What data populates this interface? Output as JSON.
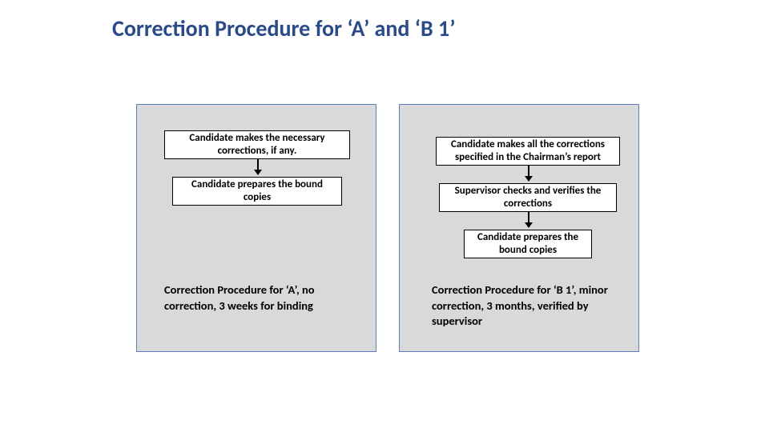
{
  "title": "Correction Procedure for ‘A’ and ‘B 1’",
  "panelA": {
    "step1": "Candidate makes the necessary corrections, if any.",
    "step2": "Candidate prepares the bound copies",
    "caption": "Correction Procedure for ‘A’, no correction, 3 weeks for binding"
  },
  "panelB": {
    "step1": "Candidate makes all the corrections specified in the Chairman’s report",
    "step2": "Supervisor checks and verifies the corrections",
    "step3": "Candidate prepares the bound copies",
    "caption": "Correction Procedure for ‘B 1’, minor correction, 3 months, verified by supervisor"
  }
}
